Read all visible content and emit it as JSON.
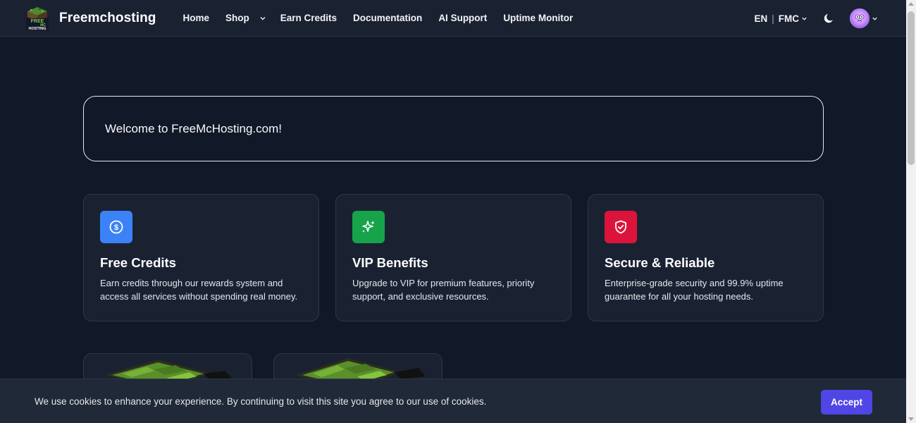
{
  "brand": {
    "name": "Freemchosting",
    "logo_text_top": "FREE",
    "logo_text_mid": "MC",
    "logo_text_bottom": "HOSTING"
  },
  "nav": {
    "items": [
      {
        "label": "Home"
      },
      {
        "label": "Shop",
        "has_dropdown": true
      },
      {
        "label": "Earn Credits"
      },
      {
        "label": "Documentation"
      },
      {
        "label": "AI Support"
      },
      {
        "label": "Uptime Monitor"
      }
    ],
    "lang": "EN",
    "currency": "FMC",
    "separator": "|"
  },
  "welcome": {
    "text": "Welcome to FreeMcHosting.com!"
  },
  "features": [
    {
      "icon": "dollar-circle-icon",
      "color": "#3b82f6",
      "title": "Free Credits",
      "desc": "Earn credits through our rewards system and access all services without spending real money."
    },
    {
      "icon": "sparkles-icon",
      "color": "#16a34a",
      "title": "VIP Benefits",
      "desc": "Upgrade to VIP for premium features, priority support, and exclusive resources."
    },
    {
      "icon": "shield-check-icon",
      "color": "#dc143c",
      "title": "Secure & Reliable",
      "desc": "Enterprise-grade security and 99.9% uptime guarantee for all your hosting needs."
    }
  ],
  "cookie": {
    "text": "We use cookies to enhance your experience. By continuing to visit this site you agree to our use of cookies.",
    "accept_label": "Accept"
  },
  "colors": {
    "background": "#111827",
    "navbar": "#1a2232",
    "accent": "#4f46e5"
  }
}
